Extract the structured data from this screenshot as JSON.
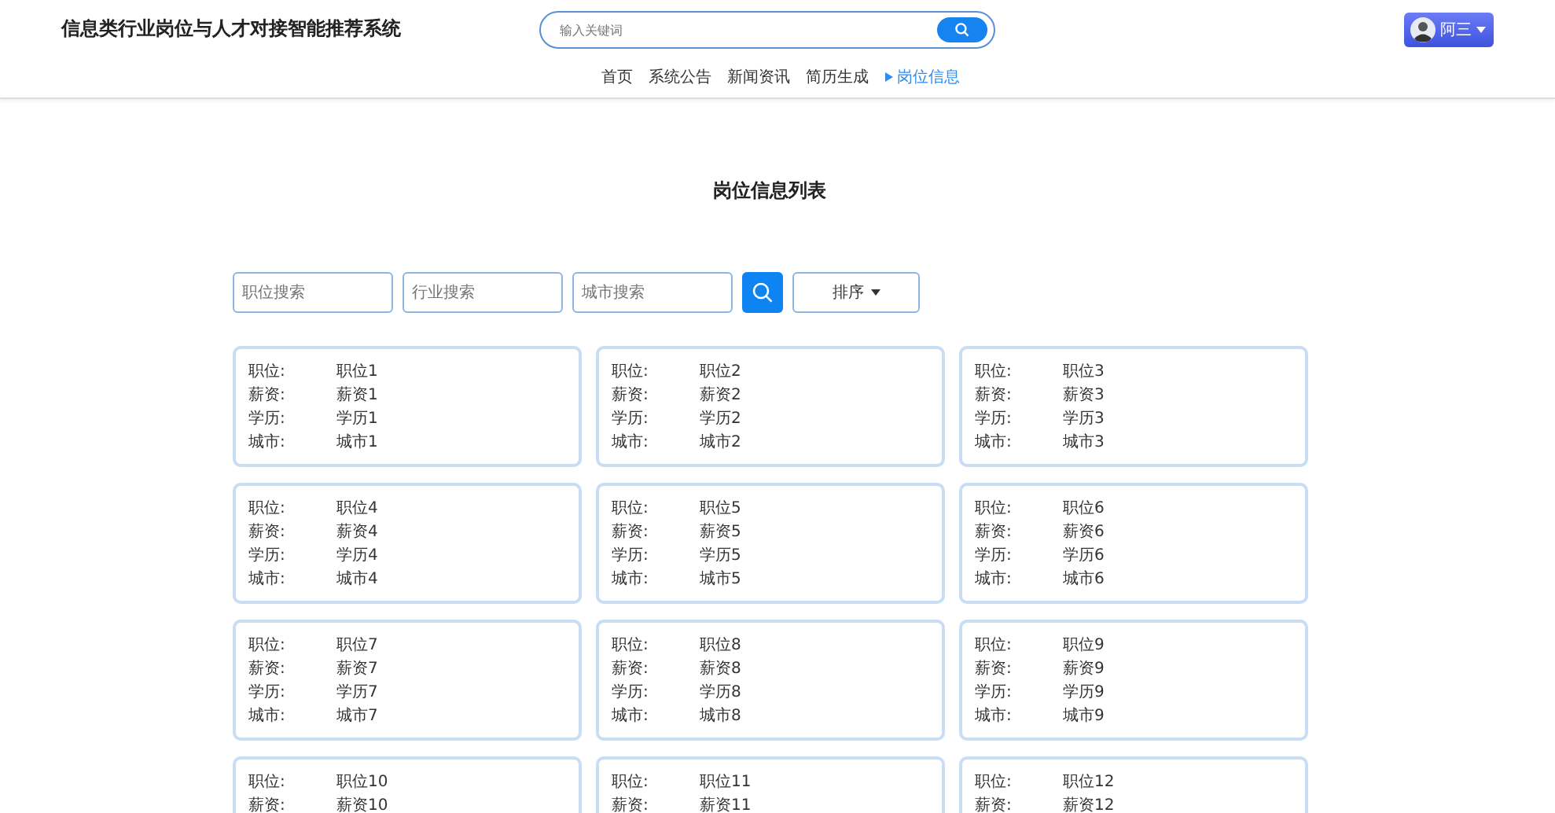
{
  "header": {
    "title": "信息类行业岗位与人才对接智能推荐系统",
    "search": {
      "placeholder": "输入关键词"
    },
    "user": {
      "name": "阿三"
    }
  },
  "nav": [
    {
      "label": "首页",
      "selected": false
    },
    {
      "label": "系统公告",
      "selected": false
    },
    {
      "label": "新闻资讯",
      "selected": false
    },
    {
      "label": "简历生成",
      "selected": false
    },
    {
      "label": "岗位信息",
      "selected": true
    }
  ],
  "page_title": "岗位信息列表",
  "filters": [
    {
      "placeholder": "职位搜索"
    },
    {
      "placeholder": "行业搜索"
    },
    {
      "placeholder": "城市搜索"
    }
  ],
  "sort_button": "排序",
  "jobs": [
    {
      "fields": [
        {
          "label": "职位:",
          "value": "职位1"
        },
        {
          "label": "薪资:",
          "value": "薪资1"
        },
        {
          "label": "学历:",
          "value": "学历1"
        },
        {
          "label": "城市:",
          "value": "城市1"
        }
      ]
    },
    {
      "fields": [
        {
          "label": "职位:",
          "value": "职位2"
        },
        {
          "label": "薪资:",
          "value": "薪资2"
        },
        {
          "label": "学历:",
          "value": "学历2"
        },
        {
          "label": "城市:",
          "value": "城市2"
        }
      ]
    },
    {
      "fields": [
        {
          "label": "职位:",
          "value": "职位3"
        },
        {
          "label": "薪资:",
          "value": "薪资3"
        },
        {
          "label": "学历:",
          "value": "学历3"
        },
        {
          "label": "城市:",
          "value": "城市3"
        }
      ]
    },
    {
      "fields": [
        {
          "label": "职位:",
          "value": "职位4"
        },
        {
          "label": "薪资:",
          "value": "薪资4"
        },
        {
          "label": "学历:",
          "value": "学历4"
        },
        {
          "label": "城市:",
          "value": "城市4"
        }
      ]
    },
    {
      "fields": [
        {
          "label": "职位:",
          "value": "职位5"
        },
        {
          "label": "薪资:",
          "value": "薪资5"
        },
        {
          "label": "学历:",
          "value": "学历5"
        },
        {
          "label": "城市:",
          "value": "城市5"
        }
      ]
    },
    {
      "fields": [
        {
          "label": "职位:",
          "value": "职位6"
        },
        {
          "label": "薪资:",
          "value": "薪资6"
        },
        {
          "label": "学历:",
          "value": "学历6"
        },
        {
          "label": "城市:",
          "value": "城市6"
        }
      ]
    },
    {
      "fields": [
        {
          "label": "职位:",
          "value": "职位7"
        },
        {
          "label": "薪资:",
          "value": "薪资7"
        },
        {
          "label": "学历:",
          "value": "学历7"
        },
        {
          "label": "城市:",
          "value": "城市7"
        }
      ]
    },
    {
      "fields": [
        {
          "label": "职位:",
          "value": "职位8"
        },
        {
          "label": "薪资:",
          "value": "薪资8"
        },
        {
          "label": "学历:",
          "value": "学历8"
        },
        {
          "label": "城市:",
          "value": "城市8"
        }
      ]
    },
    {
      "fields": [
        {
          "label": "职位:",
          "value": "职位9"
        },
        {
          "label": "薪资:",
          "value": "薪资9"
        },
        {
          "label": "学历:",
          "value": "学历9"
        },
        {
          "label": "城市:",
          "value": "城市9"
        }
      ]
    },
    {
      "fields": [
        {
          "label": "职位:",
          "value": "职位10"
        },
        {
          "label": "薪资:",
          "value": "薪资10"
        }
      ]
    },
    {
      "fields": [
        {
          "label": "职位:",
          "value": "职位11"
        },
        {
          "label": "薪资:",
          "value": "薪资11"
        }
      ]
    },
    {
      "fields": [
        {
          "label": "职位:",
          "value": "职位12"
        },
        {
          "label": "薪资:",
          "value": "薪资12"
        }
      ]
    }
  ]
}
